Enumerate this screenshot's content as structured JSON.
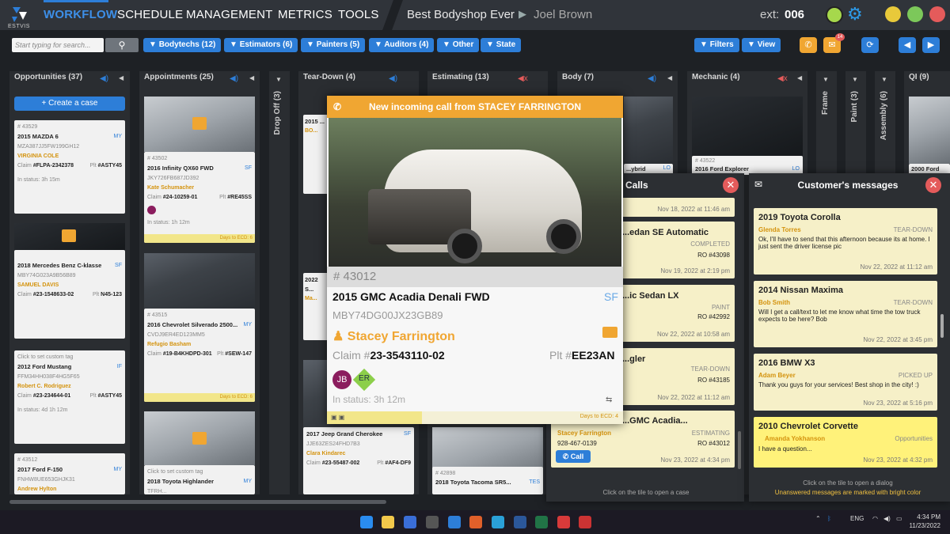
{
  "app": {
    "logo_text": "ESTVIS",
    "nav": [
      "WORKFLOW",
      "SCHEDULE",
      "MANAGEMENT",
      "METRICS",
      "TOOLS"
    ],
    "shop": "Best Bodyshop Ever",
    "user": "Joel Brown",
    "ext_label": "ext:",
    "ext_value": "006"
  },
  "toolbar": {
    "search_placeholder": "Start typing for search...",
    "filters": [
      "Bodytechs (12)",
      "Estimators (6)",
      "Painters (5)",
      "Auditors (4)",
      "Other",
      "State"
    ],
    "right": [
      "Filters",
      "View"
    ],
    "mail_badge": "14"
  },
  "columns": {
    "opportunities": "Opportunities (37)",
    "appointments": "Appointments (25)",
    "dropoff": "Drop Off (3)",
    "teardown": "Tear-Down (4)",
    "estimating": "Estimating (13)",
    "body": "Body (7)",
    "mechanic": "Mechanic (4)",
    "frame": "Frame",
    "paint": "Paint (3)",
    "assembly": "Assembly (6)",
    "qi": "QI (9)",
    "create": "Create a case"
  },
  "opp_cards": [
    {
      "num": "# 43529",
      "yr": "2015 MAZDA 6",
      "tag": "MY",
      "vin": "MZA387JJ5FW199GH12",
      "owner": "VIRGINIA COLE",
      "claim": "#FLPA-2342378",
      "plt": "#ASTY45",
      "status": "In status: 3h 15m"
    },
    {
      "yr": "2018 Mercedes Benz C-klasse",
      "tag": "SF",
      "vin": "MBY74G023A9B56B89",
      "owner": "SAMUEL DAVIS",
      "claim": "#23-1548633-02",
      "plt": "N45-123"
    },
    {
      "note": "Click to set custom tag",
      "yr": "2012 Ford Mustang",
      "tag": "IF",
      "vin": "FFM34HH038F4HG5F65",
      "owner": "Robert C. Rodriguez",
      "claim": "#23-234644-01",
      "plt": "#ASTY45",
      "status": "In status: 4d 1h 12m"
    },
    {
      "num": "# 43512",
      "yr": "2017 Ford F-150",
      "tag": "MY",
      "vin": "FNHW8UE653GHJK31",
      "owner": "Andrew Hylton"
    }
  ],
  "appt_cards": [
    {
      "num": "# 43502",
      "yr": "2016 Infinity QX60 FWD",
      "tag": "SF",
      "vin": "JKY726FB687JD392",
      "owner": "Kate Schumacher",
      "claim": "#24-10259-01",
      "plt": "#RE45SS",
      "days": "Days to ECD: 6",
      "status": "In status: 1h 12m"
    },
    {
      "num": "# 43515",
      "yr": "2016 Chevrolet Silverado 2500...",
      "tag": "MY",
      "vin": "CVDJ9ER4ED123MM5",
      "owner": "Refugio Basham",
      "claim": "#19-B4KHDPD-301",
      "plt": "#SEW-147",
      "days": "Days to ECD: 6"
    },
    {
      "note": "Click to set custom tag",
      "yr": "2018 Toyota Highlander",
      "tag": "MY",
      "vin": "TFRH..."
    }
  ],
  "teardown_cards": [
    {
      "yr": "2015 ...",
      "tag": "",
      "owner": "BO..."
    },
    {
      "yr": "2022 S...",
      "owner": "Ma..."
    },
    {
      "yr": "2017 Jeep Grand Cherokee",
      "tag": "SF",
      "vin": "JJE63ZES24FHD7B3",
      "owner": "Clara Kindarec",
      "claim": "#23-55487-002",
      "plt": "#AF4-DF9"
    }
  ],
  "est_cards": [
    {
      "num": "# 42898",
      "yr": "2018 Toyota Tacoma SR5...",
      "tag": "TES"
    }
  ],
  "body_cards": [
    {
      "yr": "...ybrid",
      "tag": "LO"
    }
  ],
  "mech_cards": [
    {
      "num": "# 43522",
      "yr": "2016 Ford Explorer",
      "tag": "LO"
    }
  ],
  "qi_cards": [
    {
      "yr": "2000 Ford F5..."
    }
  ],
  "modal": {
    "header": "New incoming call from STACEY FARRINGTON",
    "num": "# 43012",
    "car": "2015 GMC Acadia Denali FWD",
    "tag": "SF",
    "vin": "MBY74DG00JX23GB89",
    "owner": "Stacey Farrington",
    "claim_label": "Claim #",
    "claim": "23-3543110-02",
    "plt_label": "Plt #",
    "plt": "EE23AN",
    "avatar1": "JB",
    "avatar2": "ER",
    "status": "In status: 3h 12m",
    "days": "Days to ECD: 4"
  },
  "calls": {
    "title": "Calls",
    "items": [
      {
        "title": "",
        "state": "",
        "ro": "",
        "date": "Nov 18, 2022 at 11:46 am"
      },
      {
        "title": "...edan SE Automatic",
        "state": "COMPLETED",
        "ro": "RO #43098",
        "date": "Nov 19, 2022 at 2:19 pm"
      },
      {
        "title": "...ic Sedan LX",
        "state": "PAINT",
        "ro": "RO #42992",
        "date": "Nov 22, 2022 at 10:58 am"
      },
      {
        "title": "...gler",
        "state": "TEAR-DOWN",
        "ro": "RO #43185",
        "date": "Nov 22, 2022 at 11:12 am"
      },
      {
        "title": "...GMC Acadia...",
        "name": "Stacey Farrington",
        "phone": "928-467-0139",
        "state": "ESTIMATING",
        "ro": "RO #43012",
        "date": "Nov 23, 2022 at 4:34 pm",
        "btn": "Call"
      }
    ],
    "footer": "Click on the tile to open a case"
  },
  "messages": {
    "title": "Customer's messages",
    "items": [
      {
        "car": "2019 Toyota Corolla",
        "name": "Glenda Torres",
        "state": "TEAR-DOWN",
        "text": "Ok, I'll have to send that this afternoon because its at home. I just sent the driver license pic",
        "date": "Nov 22, 2022 at 11:12 am"
      },
      {
        "car": "2014 Nissan Maxima",
        "name": "Bob Smith",
        "state": "TEAR-DOWN",
        "text": "Will I get a call/text to let me know what time the tow truck expects to be here? Bob",
        "date": "Nov 22, 2022 at 3:45 pm"
      },
      {
        "car": "2016 BMW X3",
        "name": "Adam Beyer",
        "state": "PICKED UP",
        "text": "Thank you guys for your services! Best shop in the city! :)",
        "date": "Nov 23, 2022 at 5:16 pm"
      },
      {
        "car": "2010 Chevrolet Corvette",
        "name": "Amanda Yokhanson",
        "state": "Opportunities",
        "text": "I have a question...",
        "date": "Nov 23, 2022 at 4:32 pm"
      }
    ],
    "footer1": "Click on the tile to open a dialog",
    "footer2": "Unanswered messages are marked with bright color"
  },
  "taskbar": {
    "lang": "ENG",
    "time": "4:34 PM",
    "date": "11/23/2022"
  },
  "colors": {
    "accent": "#2d7ed8",
    "orange": "#f0a632",
    "owner": "#d4930e",
    "tile": "#f6f0c8",
    "tile_hi": "#fff27a"
  }
}
